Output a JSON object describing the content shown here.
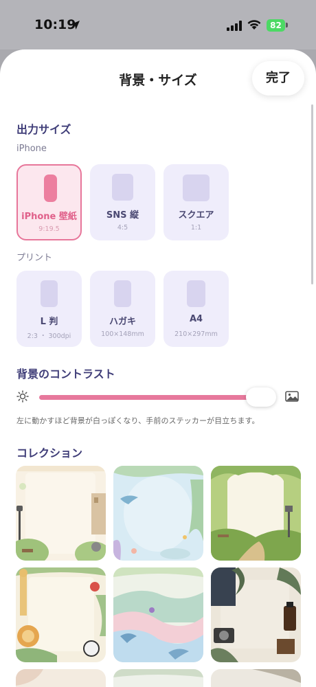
{
  "status_bar": {
    "time": "10:19",
    "battery_level": "82"
  },
  "sheet": {
    "title": "背景・サイズ",
    "done_label": "完了"
  },
  "output_size": {
    "title": "出力サイズ",
    "iphone_label": "iPhone",
    "iphone_cards": [
      {
        "name": "iPhone 壁紙",
        "ratio": "9:19.5",
        "selected": true
      },
      {
        "name": "SNS 縦",
        "ratio": "4:5",
        "selected": false
      },
      {
        "name": "スクエア",
        "ratio": "1:1",
        "selected": false
      }
    ],
    "print_label": "プリント",
    "print_cards": [
      {
        "name": "L 判",
        "ratio": "2:3 ・ 300dpi",
        "selected": false
      },
      {
        "name": "ハガキ",
        "ratio": "100×148mm",
        "selected": false
      },
      {
        "name": "A4",
        "ratio": "210×297mm",
        "selected": false
      }
    ]
  },
  "contrast": {
    "title": "背景のコントラスト",
    "value_fraction": 0.94,
    "hint": "左に動かすほど背景が白っぽくなり、手前のステッカーが目立ちます。"
  },
  "collection": {
    "title": "コレクション",
    "items": [
      {
        "name": "town-lamp-frame"
      },
      {
        "name": "ocean-dolphin-frame"
      },
      {
        "name": "green-hills-frame"
      },
      {
        "name": "animal-jungle-frame"
      },
      {
        "name": "pastel-sea-frame"
      },
      {
        "name": "camera-plants-frame"
      }
    ]
  },
  "colors": {
    "accent_pink": "#e7769a",
    "heading_purple": "#3f3d78",
    "card_bg": "#efedfb"
  }
}
